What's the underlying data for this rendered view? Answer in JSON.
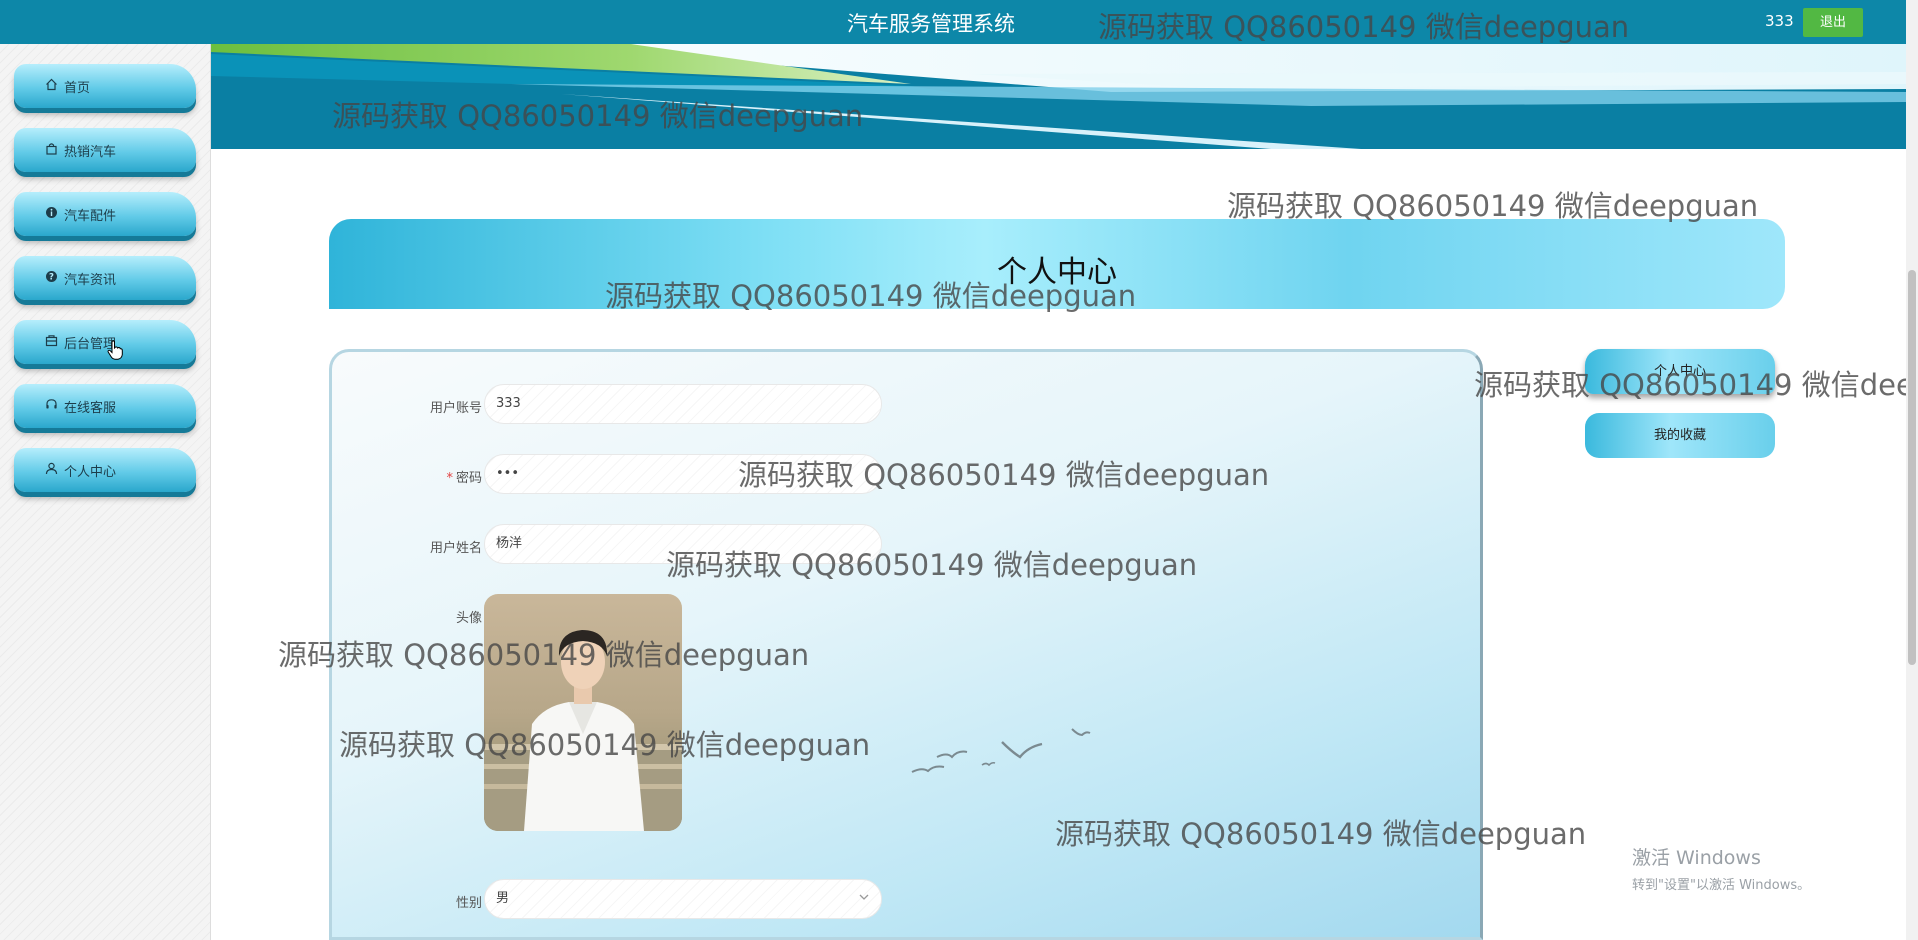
{
  "header": {
    "app_title": "汽车服务管理系统",
    "username": "333",
    "logout_label": "退出"
  },
  "sidebar": {
    "items": [
      {
        "label": "首页",
        "icon": "home-icon"
      },
      {
        "label": "热销汽车",
        "icon": "bag-icon"
      },
      {
        "label": "汽车配件",
        "icon": "info-icon"
      },
      {
        "label": "汽车资讯",
        "icon": "question-icon"
      },
      {
        "label": "后台管理",
        "icon": "box-icon"
      },
      {
        "label": "在线客服",
        "icon": "headset-icon"
      },
      {
        "label": "个人中心",
        "icon": "user-icon"
      }
    ]
  },
  "page": {
    "title": "个人中心"
  },
  "form": {
    "account_label": "用户账号",
    "account_value": "333",
    "password_label": "密码",
    "password_required_mark": "*",
    "password_value": "•••",
    "name_label": "用户姓名",
    "name_value": "杨洋",
    "avatar_label": "头像",
    "gender_label": "性别",
    "gender_value": "男"
  },
  "side_menu": {
    "items": [
      {
        "label": "个人中心",
        "active": true
      },
      {
        "label": "我的收藏",
        "active": false
      }
    ]
  },
  "watermark": {
    "text": "源码获取 QQ86050149 微信deepguan"
  },
  "windows_activation": {
    "title": "激活 Windows",
    "subtitle": "转到\"设置\"以激活 Windows。"
  },
  "colors": {
    "topbar": "#0d87a8",
    "logout_button": "#52b843",
    "accent_cyan": "#62cbe8"
  }
}
